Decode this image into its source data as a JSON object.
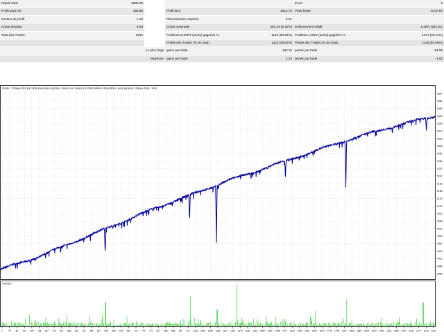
{
  "report": {
    "rows": [
      [
        "Dépôt initial",
        "5000.00",
        "",
        "",
        "",
        "Ecart",
        "2"
      ],
      [
        "Profit total net",
        "483.86",
        "",
        "Profit brut",
        "2613.74",
        "Perte brute",
        "-2147.87"
      ],
      [
        "Facteur de profit",
        "1.22",
        "",
        "Rémunération espérée",
        "0.21",
        "",
        ""
      ],
      [
        "Chute absolue",
        "8.90",
        "",
        "Chute maximale",
        "291.34 (5.40%)",
        "Enfoncement relatif",
        "5.40% (291.34)"
      ],
      [
        "Total des Trades",
        "2234",
        "",
        "Positions SHORT (vente) gagnées %",
        "1163 (50.84%)",
        "Positions LONG (achat) gagnées %",
        "1071 (49.11%)"
      ],
      [
        "",
        "",
        "",
        "Profits des Trades (% du total)",
        "1115 (49.91%)",
        "Pertes des Trades (% du total)",
        "1119 (50.09%)"
      ],
      [
        "",
        "",
        "Le plus large",
        "gains par trade",
        "163.34",
        "pertes par trade",
        "-64.86"
      ],
      [
        "",
        "",
        "Moyenne",
        "gains par trade",
        "2.34",
        "pertes par trade",
        "-1.92"
      ],
      [
        "",
        "",
        "Maximum",
        "gains consécutifs (profit en $)",
        "10 (10.25)",
        "pertes consécutives (perte en $)",
        "9 (-9.02)"
      ],
      [
        "",
        "",
        "Maximum",
        "Gains consécutifs (coups gagnants)",
        "164.19 (2)",
        "Pertes consécutives (coups perdants)",
        "-84.86 (1)"
      ],
      [
        "",
        "",
        "Moyenne",
        "gains consécutifs",
        "2",
        "Pertes consécutives",
        "2"
      ]
    ]
  },
  "chart_data": [
    {
      "type": "line",
      "title": "Solde / Chaque tick (la méthode la plus précise, basée sur toutes les informations disponibles pour générer chaque tick) / Vols",
      "x": [
        0,
        200,
        400,
        600,
        800,
        1000,
        1200,
        1400,
        1600,
        1800,
        2000,
        2200,
        2265
      ],
      "series": [
        {
          "values": [
            4890,
            4935,
            4990,
            5045,
            5100,
            5150,
            5200,
            5245,
            5290,
            5335,
            5375,
            5410,
            5420
          ],
          "color": "#0000a0"
        }
      ],
      "drawdowns": [
        {
          "x": 545,
          "depth": 88
        },
        {
          "x": 985,
          "depth": 92
        },
        {
          "x": 1125,
          "depth": 196
        },
        {
          "x": 1800,
          "depth": 161
        },
        {
          "x": 1485,
          "depth": 47
        },
        {
          "x": 2220,
          "depth": 40
        }
      ],
      "yticks": [
        "5507",
        "5480",
        "5453",
        "5426",
        "5399",
        "5372",
        "5345",
        "5318",
        "5291",
        "5264",
        "5237",
        "5210",
        "5183",
        "5156",
        "5129",
        "5102",
        "5075",
        "5048",
        "5021",
        "4994",
        "4967",
        "4940",
        "4913",
        "4886",
        "4859"
      ],
      "xticks": [
        "0",
        "40",
        "80",
        "121",
        "159",
        "198",
        "237",
        "276",
        "314",
        "353",
        "392",
        "431",
        "469",
        "507",
        "546",
        "585",
        "624",
        "662",
        "701",
        "740",
        "779",
        "817",
        "856",
        "895",
        "934",
        "972",
        "1011",
        "1050",
        "1089",
        "1128",
        "1167",
        "1205",
        "1244",
        "1283",
        "1322",
        "1360",
        "1399",
        "1438",
        "1477",
        "1515",
        "1554",
        "1593",
        "1632",
        "1670",
        "1709",
        "1748",
        "1787",
        "1825",
        "1864",
        "1903",
        "1942",
        "1980",
        "2019",
        "2058",
        "2097",
        "2135",
        "2174",
        "2213",
        "2252"
      ],
      "grid": true
    },
    {
      "type": "bar",
      "title": "Volume",
      "series": [
        {
          "color": "#33cc33"
        }
      ]
    }
  ]
}
